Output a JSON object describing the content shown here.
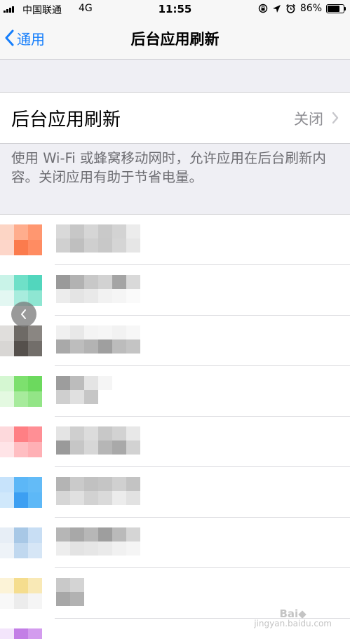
{
  "status_bar": {
    "carrier": "中国联通",
    "network": "4G",
    "time": "11:55",
    "battery": "86%",
    "battery_level": 0.86
  },
  "nav": {
    "back_label": "通用",
    "title": "后台应用刷新"
  },
  "setting": {
    "label": "后台应用刷新",
    "value": "关闭"
  },
  "footer": "使用 Wi-Fi 或蜂窝移动网时，允许应用在后台刷新内容。关闭应用有助于节省电量。",
  "apps": [
    {
      "icon": [
        "#fcd5c5",
        "#ffad8d",
        "#ff9770",
        "#fdd6c9",
        "#fb7b4d",
        "#ff8c62"
      ],
      "name": [
        "#d9d9d9",
        "#c7c7c7",
        "#d6d6d6",
        "#c9c9c9",
        "#d3d3d3",
        "#ececec",
        "#d0d0d0",
        "#bfbfbf",
        "#cfcfcf",
        "#c8c8c8",
        "#d5d5d5",
        "#e6e6e6"
      ]
    },
    {
      "icon": [
        "#c9f3e8",
        "#6fe0c8",
        "#52d6bd",
        "#e3f7f2",
        "#a8ecdd",
        "#8ee6d2"
      ],
      "name": [
        "#9a9a9a",
        "#b2b2b2",
        "#c8c8c8",
        "#d2d2d2",
        "#a4a4a4",
        "#d9d9d9",
        "#ececec",
        "#e4e4e4",
        "#e9e9e9",
        "#f2f2f2",
        "#f5f5f5",
        "#fafafa"
      ]
    },
    {
      "icon": [
        "#e0dedc",
        "#6e6a66",
        "#8a8682",
        "#d8d6d4",
        "#55504c",
        "#726e6a"
      ],
      "name": [
        "#f0f0f0",
        "#e8e8e8",
        "#f4f4f4",
        "#f6f6f6",
        "#f2f2f2",
        "#f7f7f7",
        "#a9a9a9",
        "#bdbdbd",
        "#b3b3b3",
        "#9f9f9f",
        "#bcbcbc",
        "#c4c4c4"
      ]
    },
    {
      "icon": [
        "#d5f7d2",
        "#7de06e",
        "#6cd95e",
        "#e4f9e1",
        "#a7eb9c",
        "#93e587"
      ],
      "name": [
        "#9d9d9d",
        "#bcbcbc",
        "#e4e4e4",
        "#f5f5f5",
        "#ffffff",
        "#ffffff",
        "#cfcfcf",
        "#e0e0e0",
        "#c6c6c6",
        "#ffffff",
        "#ffffff",
        "#ffffff"
      ]
    },
    {
      "icon": [
        "#fdd9dc",
        "#ff7f84",
        "#ff8f95",
        "#ffe4e7",
        "#ffbec2",
        "#ffb0b5"
      ],
      "name": [
        "#e4e4e4",
        "#cfcfcf",
        "#dcdcdc",
        "#c8c8c8",
        "#d2d2d2",
        "#e8e8e8",
        "#9a9a9a",
        "#c6c6c6",
        "#d7d7d7",
        "#b6b6b6",
        "#a9a9a9",
        "#d2d2d2"
      ]
    },
    {
      "icon": [
        "#c7e3fb",
        "#5cb7f7",
        "#63bbf7",
        "#d0e8fb",
        "#3c9ff2",
        "#5db8f7"
      ],
      "name": [
        "#b4b4b4",
        "#cacaca",
        "#c1c1c1",
        "#c5c5c5",
        "#d0d0d0",
        "#c3c3c3",
        "#d6d6d6",
        "#e0e0e0",
        "#d2d2d2",
        "#dadada",
        "#ececec",
        "#e2e2e2"
      ]
    },
    {
      "icon": [
        "#e7eef6",
        "#a8c8e6",
        "#c8def4",
        "#eef3f8",
        "#c0d8ef",
        "#d6e6f6"
      ],
      "name": [
        "#b6b6b6",
        "#a8a8a8",
        "#b7b7b7",
        "#9e9e9e",
        "#bababa",
        "#d5d5d5",
        "#ededed",
        "#e3e3e3",
        "#e6e6e6",
        "#eaeaea",
        "#f1f1f1",
        "#f5f5f5"
      ]
    },
    {
      "icon": [
        "#fcf3d7",
        "#f5dd8e",
        "#f9e9b6",
        "#f8f8f8",
        "#ececec",
        "#f5f5f5"
      ],
      "name": [
        "#c9c9c9",
        "#d4d4d4",
        "#ffffff",
        "#ffffff",
        "#ffffff",
        "#ffffff",
        "#a7a7a7",
        "#b2b2b2",
        "#ffffff",
        "#ffffff",
        "#ffffff",
        "#ffffff"
      ]
    },
    {
      "icon": [
        "#f3e5fb",
        "#c37ee6",
        "#d39cee",
        "#ffffff",
        "#ffffff",
        "#ffffff"
      ],
      "name": [
        "#ffffff",
        "#ffffff",
        "#ffffff",
        "#ffffff",
        "#ffffff",
        "#ffffff",
        "#ffffff",
        "#ffffff",
        "#ffffff",
        "#ffffff",
        "#ffffff",
        "#ffffff"
      ]
    }
  ],
  "accent_color": "#157efb",
  "watermark": {
    "logo": "Bai",
    "sub": "jingyan.baidu.com"
  }
}
